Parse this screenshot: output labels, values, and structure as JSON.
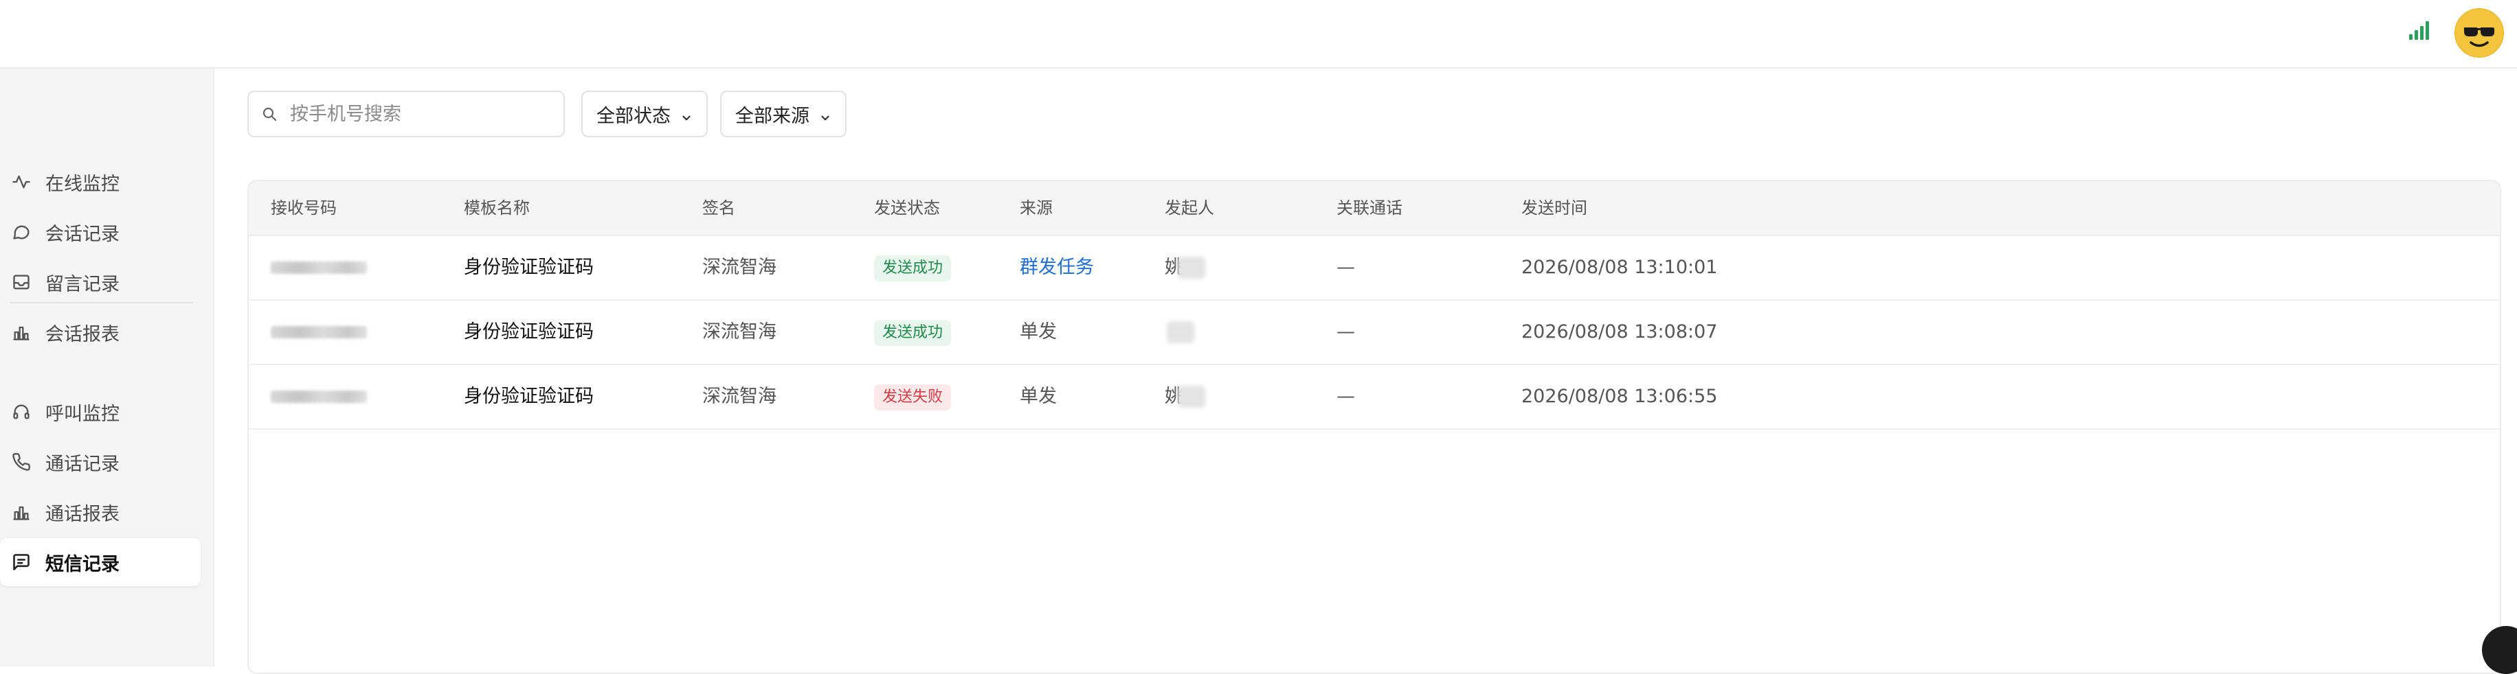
{
  "topbar": {
    "signal_icon": "signal-bars-icon",
    "avatar_emoji": "😎",
    "accent": "#2aa05a"
  },
  "sidebar": {
    "items": [
      {
        "label": "在线监控",
        "icon": "activity-icon"
      },
      {
        "label": "会话记录",
        "icon": "chat-bubble-icon"
      },
      {
        "label": "留言记录",
        "icon": "inbox-icon"
      },
      {
        "label": "会话报表",
        "icon": "bar-chart-icon"
      },
      {
        "label": "呼叫监控",
        "icon": "headset-icon"
      },
      {
        "label": "通话记录",
        "icon": "phone-icon"
      },
      {
        "label": "通话报表",
        "icon": "bar-chart-icon"
      },
      {
        "label": "短信记录",
        "icon": "message-square-icon",
        "active": true
      }
    ]
  },
  "filters": {
    "search_placeholder": "按手机号搜索",
    "search_value": "",
    "status_selected": "全部状态",
    "source_selected": "全部来源"
  },
  "table": {
    "columns": [
      "接收号码",
      "模板名称",
      "签名",
      "发送状态",
      "来源",
      "发起人",
      "关联通话",
      "发送时间"
    ],
    "rows": [
      {
        "phone": "",
        "template": "身份验证验证码",
        "signature": "深流智海",
        "status": "发送成功",
        "status_type": "success",
        "source": "群发任务",
        "initiator": "姚",
        "related_call": "—",
        "time": "2026/08/08 13:10:01"
      },
      {
        "phone": "",
        "template": "身份验证验证码",
        "signature": "深流智海",
        "status": "发送成功",
        "status_type": "success",
        "source": "单发",
        "initiator": "",
        "related_call": "—",
        "time": "2026/08/08 13:08:07"
      },
      {
        "phone": "",
        "template": "身份验证验证码",
        "signature": "深流智海",
        "status": "发送失败",
        "status_type": "fail",
        "source": "单发",
        "initiator": "姚",
        "related_call": "—",
        "time": "2026/08/08 13:06:55"
      }
    ]
  },
  "colors": {
    "success_bg": "#e8f6ee",
    "success_text": "#1f8a4c",
    "fail_bg": "#fde9ea",
    "fail_text": "#d63b44",
    "link": "#1f6fd1"
  }
}
